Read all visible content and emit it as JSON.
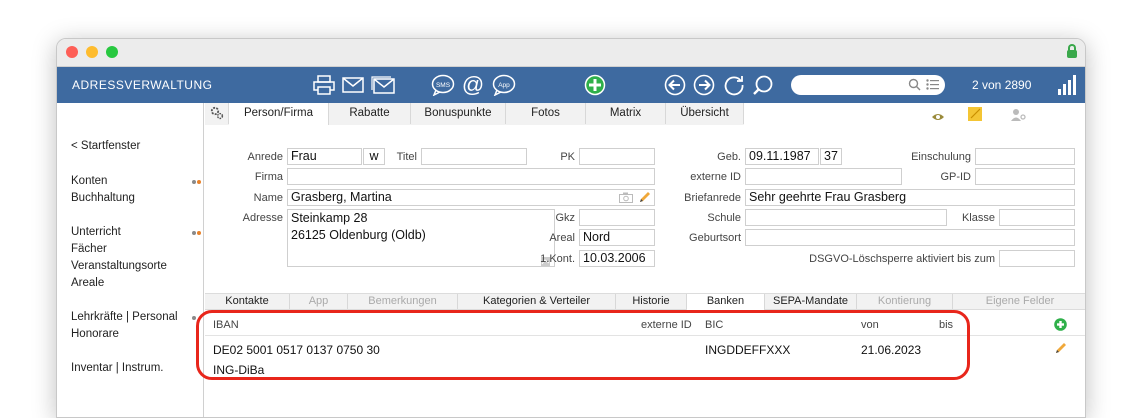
{
  "header": {
    "title": "ADRESSVERWALTUNG",
    "counter": "2 von 2890",
    "search_placeholder": ""
  },
  "toolbar_icons": [
    "print-icon",
    "email-icon",
    "email-all-icon",
    "sms-icon",
    "at-icon",
    "app-icon",
    "add-icon",
    "back-icon",
    "forward-icon",
    "refresh-icon",
    "find-icon"
  ],
  "sidebar": {
    "items": [
      {
        "label": "< Startfenster"
      },
      {
        "label": "Konten"
      },
      {
        "label": "Buchhaltung"
      },
      {
        "label": "Unterricht"
      },
      {
        "label": "Fächer"
      },
      {
        "label": "Veranstaltungsorte"
      },
      {
        "label": "Areale"
      },
      {
        "label": "Lehrkräfte | Personal"
      },
      {
        "label": "Honorare"
      },
      {
        "label": "Inventar | Instrum."
      }
    ]
  },
  "tabs_top": [
    {
      "label": "Person/Firma",
      "active": true
    },
    {
      "label": "Rabatte"
    },
    {
      "label": "Bonuspunkte"
    },
    {
      "label": "Fotos"
    },
    {
      "label": "Matrix"
    },
    {
      "label": "Übersicht"
    }
  ],
  "form": {
    "anrede_label": "Anrede",
    "anrede": "Frau",
    "anrede_code": "w",
    "titel_label": "Titel",
    "titel": "",
    "pk_label": "PK",
    "pk": "",
    "firma_label": "Firma",
    "firma": "",
    "name_label": "Name",
    "name": "Grasberg, Martina",
    "adresse_label": "Adresse",
    "adresse_line1": "Steinkamp 28",
    "adresse_line2": "26125 Oldenburg (Oldb)",
    "gkz_label": "Gkz",
    "gkz": "",
    "areal_label": "Areal",
    "areal": "Nord",
    "kont_label": "1.Kont.",
    "kont": "10.03.2006",
    "geb_label": "Geb.",
    "geb": "09.11.1987",
    "alter": "37",
    "einschulung_label": "Einschulung",
    "einschulung": "",
    "externe_id_label": "externe ID",
    "externe_id": "",
    "gp_id_label": "GP-ID",
    "gp_id": "",
    "briefanrede_label": "Briefanrede",
    "briefanrede": "Sehr geehrte Frau Grasberg",
    "schule_label": "Schule",
    "schule": "",
    "klasse_label": "Klasse",
    "klasse": "",
    "geburtsort_label": "Geburtsort",
    "geburtsort": "",
    "dsgvo_label": "DSGVO-Löschsperre aktiviert bis zum",
    "dsgvo": ""
  },
  "tabs_mid": [
    {
      "label": "Kontakte"
    },
    {
      "label": "App",
      "disabled": true
    },
    {
      "label": "Bemerkungen",
      "disabled": true
    },
    {
      "label": "Kategorien & Verteiler"
    },
    {
      "label": "Historie"
    },
    {
      "label": "Banken",
      "active": true
    },
    {
      "label": "SEPA-Mandate"
    },
    {
      "label": "Kontierung",
      "disabled": true
    },
    {
      "label": "Eigene Felder",
      "disabled": true
    }
  ],
  "banks_table": {
    "columns": {
      "iban": "IBAN",
      "externe_id": "externe ID",
      "bic": "BIC",
      "von": "von",
      "bis": "bis"
    },
    "rows": [
      {
        "iban": "DE02 5001 0517 0137 0750 30",
        "bank": "ING-DiBa",
        "externe_id": "",
        "bic": "INGDDEFFXXX",
        "von": "21.06.2023",
        "bis": ""
      }
    ]
  },
  "colors": {
    "toolbar": "#3e6aa0",
    "highlight": "#e8261b",
    "add_green": "#2fb04a",
    "dot_orange": "#e8822a",
    "dot_gray": "#8a8a8a"
  }
}
